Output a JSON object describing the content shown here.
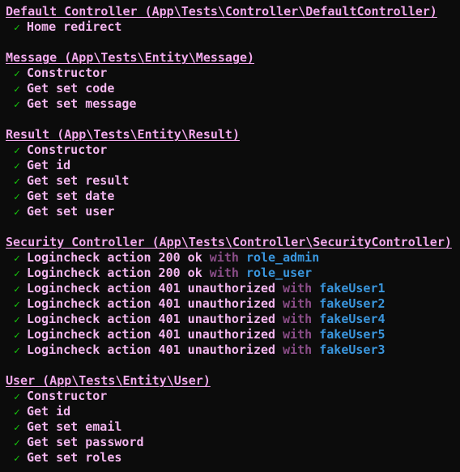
{
  "colors": {
    "background": "#0c0c0c",
    "suite_header": "#f2a9ec",
    "test_name": "#f4b6ef",
    "check": "#16c60c",
    "with_keyword": "#8a4d87",
    "data_label": "#3a96dd"
  },
  "check_glyph": "✓",
  "with_word": "with",
  "suites": [
    {
      "title": "Default Controller (App\\Tests\\Controller\\DefaultController)",
      "tests": [
        {
          "name": "Home redirect"
        }
      ]
    },
    {
      "title": "Message (App\\Tests\\Entity\\Message)",
      "tests": [
        {
          "name": "Constructor"
        },
        {
          "name": "Get set code"
        },
        {
          "name": "Get set message"
        }
      ]
    },
    {
      "title": "Result (App\\Tests\\Entity\\Result)",
      "tests": [
        {
          "name": "Constructor"
        },
        {
          "name": "Get id"
        },
        {
          "name": "Get set result"
        },
        {
          "name": "Get set date"
        },
        {
          "name": "Get set user"
        }
      ]
    },
    {
      "title": "Security Controller (App\\Tests\\Controller\\SecurityController)",
      "tests": [
        {
          "name": "Logincheck action 200 ok",
          "data": "role_admin"
        },
        {
          "name": "Logincheck action 200 ok",
          "data": "role_user"
        },
        {
          "name": "Logincheck action 401 unauthorized",
          "data": "fakeUser1"
        },
        {
          "name": "Logincheck action 401 unauthorized",
          "data": "fakeUser2"
        },
        {
          "name": "Logincheck action 401 unauthorized",
          "data": "fakeUser4"
        },
        {
          "name": "Logincheck action 401 unauthorized",
          "data": "fakeUser5"
        },
        {
          "name": "Logincheck action 401 unauthorized",
          "data": "fakeUser3"
        }
      ]
    },
    {
      "title": "User (App\\Tests\\Entity\\User)",
      "tests": [
        {
          "name": "Constructor"
        },
        {
          "name": "Get id"
        },
        {
          "name": "Get set email"
        },
        {
          "name": "Get set password"
        },
        {
          "name": "Get set roles"
        }
      ]
    }
  ]
}
